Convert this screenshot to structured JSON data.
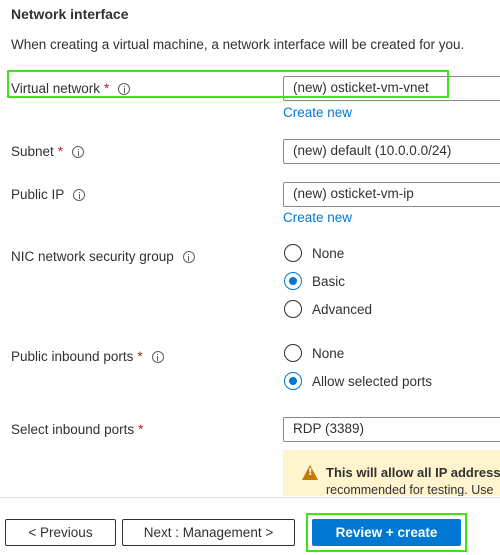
{
  "section": {
    "title": "Network interface",
    "description": "When creating a virtual machine, a network interface will be created for you."
  },
  "fields": {
    "virtual_network": {
      "label": "Virtual network",
      "required": "*",
      "value": "(new) osticket-vm-vnet",
      "link": "Create new"
    },
    "subnet": {
      "label": "Subnet",
      "required": "*",
      "value": "(new) default (10.0.0.0/24)"
    },
    "public_ip": {
      "label": "Public IP",
      "value": "(new) osticket-vm-ip",
      "link": "Create new"
    },
    "nic_nsg": {
      "label": "NIC network security group",
      "options": [
        "None",
        "Basic",
        "Advanced"
      ],
      "selected": "Basic"
    },
    "public_inbound_ports": {
      "label": "Public inbound ports",
      "required": "*",
      "options": [
        "None",
        "Allow selected ports"
      ],
      "selected": "Allow selected ports"
    },
    "select_inbound_ports": {
      "label": "Select inbound ports",
      "required": "*",
      "value": "RDP (3389)"
    }
  },
  "warning": {
    "icon": "warning-icon",
    "title": "This will allow all IP addresses",
    "body": "recommended for testing.  Use"
  },
  "footer": {
    "previous": "< Previous",
    "next": "Next : Management >",
    "review": "Review + create"
  },
  "colors": {
    "accent": "#0078d4",
    "highlight": "#3ee31b",
    "required": "#a4262c",
    "warning_bg": "#fff4ce"
  }
}
